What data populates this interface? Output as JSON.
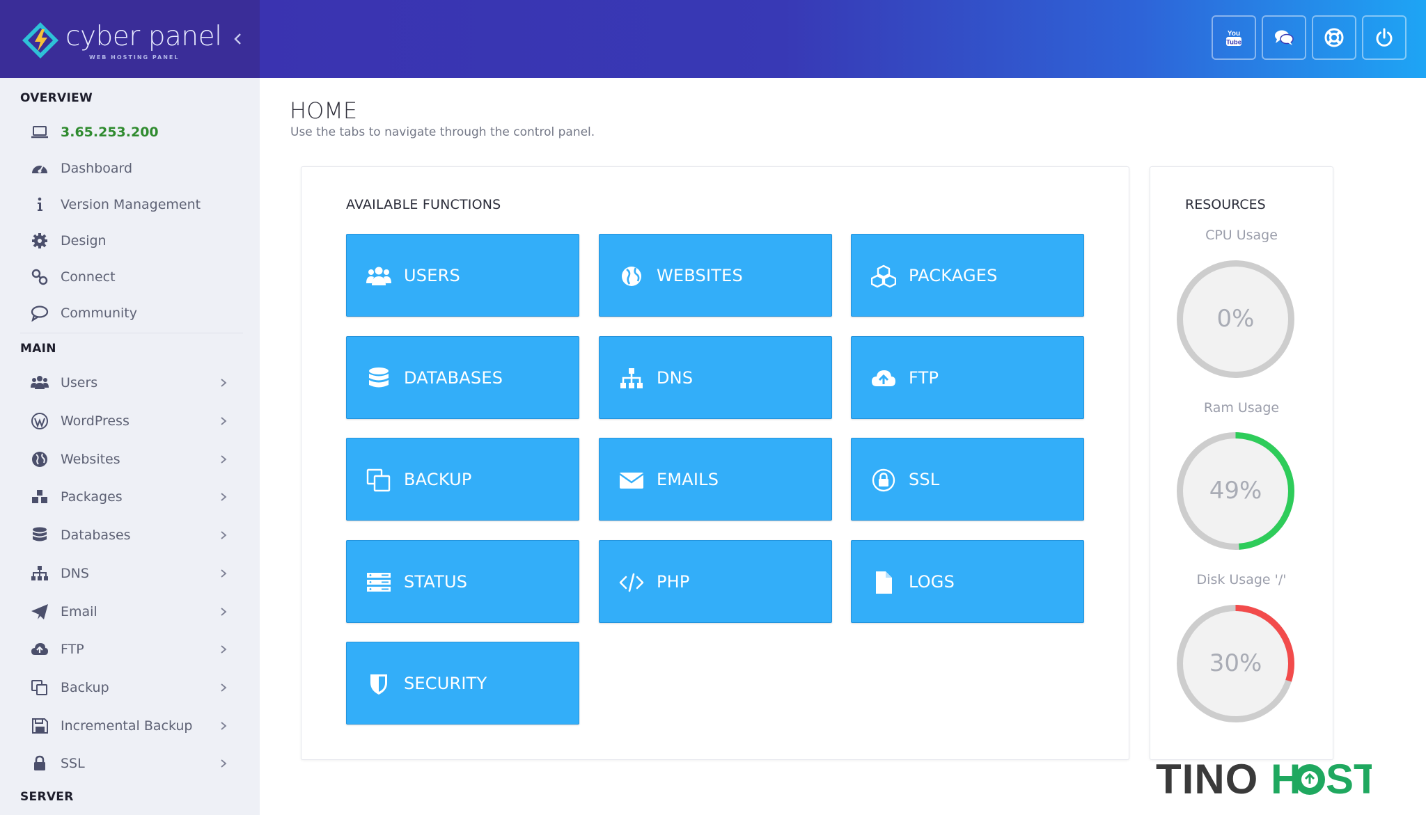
{
  "brand": {
    "name": "cyber panel",
    "tagline": "WEB HOSTING PANEL",
    "colors": {
      "sidebar_brand": "#3a2d98",
      "header_end": "#1ea5f5",
      "tile": "#33aef9"
    }
  },
  "header": {
    "buttons": [
      {
        "name": "youtube-button",
        "icon": "youtube-icon"
      },
      {
        "name": "chat-button",
        "icon": "chat-bubbles-icon"
      },
      {
        "name": "support-button",
        "icon": "life-ring-icon"
      },
      {
        "name": "logout-button",
        "icon": "power-icon"
      }
    ]
  },
  "sidebar": {
    "sections": {
      "overview": "OVERVIEW",
      "main": "MAIN",
      "server": "SERVER"
    },
    "overview_items": [
      {
        "label": "3.65.253.200",
        "icon": "laptop-icon"
      },
      {
        "label": "Dashboard",
        "icon": "dashboard-icon"
      },
      {
        "label": "Version Management",
        "icon": "info-icon"
      },
      {
        "label": "Design",
        "icon": "gear-icon"
      },
      {
        "label": "Connect",
        "icon": "link-icon"
      },
      {
        "label": "Community",
        "icon": "chat-icon"
      }
    ],
    "main_items": [
      {
        "label": "Users",
        "icon": "users-icon"
      },
      {
        "label": "WordPress",
        "icon": "wordpress-icon"
      },
      {
        "label": "Websites",
        "icon": "globe-icon"
      },
      {
        "label": "Packages",
        "icon": "cubes-icon"
      },
      {
        "label": "Databases",
        "icon": "database-icon"
      },
      {
        "label": "DNS",
        "icon": "sitemap-icon"
      },
      {
        "label": "Email",
        "icon": "paper-plane-icon"
      },
      {
        "label": "FTP",
        "icon": "cloud-upload-icon"
      },
      {
        "label": "Backup",
        "icon": "copy-icon"
      },
      {
        "label": "Incremental Backup",
        "icon": "floppy-icon"
      },
      {
        "label": "SSL",
        "icon": "lock-icon"
      }
    ]
  },
  "main": {
    "title": "HOME",
    "subtitle": "Use the tabs to navigate through the control panel.",
    "functions_title": "AVAILABLE FUNCTIONS",
    "functions": [
      {
        "label": "USERS",
        "icon": "users-icon"
      },
      {
        "label": "WEBSITES",
        "icon": "globe-icon"
      },
      {
        "label": "PACKAGES",
        "icon": "cubes-icon"
      },
      {
        "label": "DATABASES",
        "icon": "database-icon"
      },
      {
        "label": "DNS",
        "icon": "sitemap-icon"
      },
      {
        "label": "FTP",
        "icon": "cloud-upload-icon"
      },
      {
        "label": "BACKUP",
        "icon": "copy-icon"
      },
      {
        "label": "EMAILS",
        "icon": "envelope-icon"
      },
      {
        "label": "SSL",
        "icon": "lock-icon"
      },
      {
        "label": "STATUS",
        "icon": "server-icon"
      },
      {
        "label": "PHP",
        "icon": "code-icon"
      },
      {
        "label": "LOGS",
        "icon": "file-icon"
      },
      {
        "label": "SECURITY",
        "icon": "shield-icon"
      }
    ]
  },
  "resources": {
    "title": "RESOURCES",
    "gauges": [
      {
        "label": "CPU Usage",
        "value": "0%",
        "percent": 0,
        "color": "#2ecc5a"
      },
      {
        "label": "Ram Usage",
        "value": "49%",
        "percent": 49,
        "color": "#2ecc5a"
      },
      {
        "label": "Disk Usage '/'",
        "value": "30%",
        "percent": 30,
        "color": "#f24b4b"
      }
    ]
  },
  "watermark": {
    "text": "TINOHOST"
  }
}
